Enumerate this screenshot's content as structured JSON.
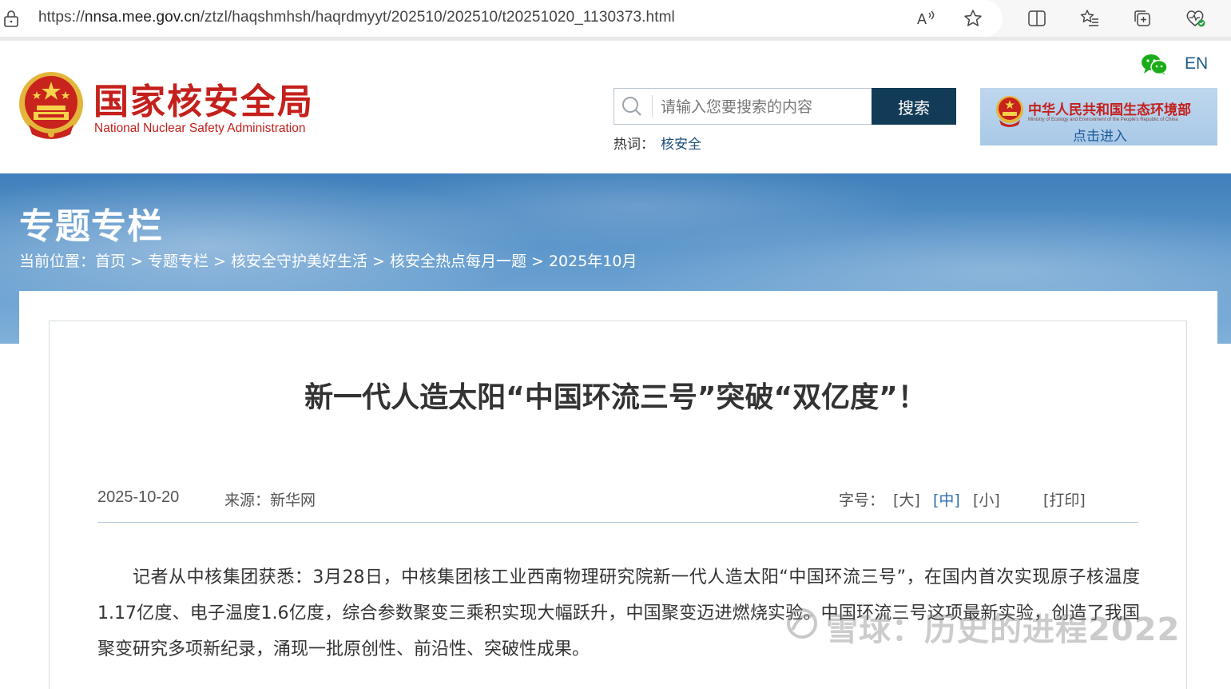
{
  "browser": {
    "url_prefix": "https://",
    "url_host": "nnsa.mee.gov.cn",
    "url_path": "/ztzl/haqshmhsh/haqrdmyyt/202510/202510/t20251020_1130373.html"
  },
  "header": {
    "site_title": "国家核安全局",
    "site_subtitle": "National Nuclear Safety Administration",
    "lang_link": "EN",
    "search": {
      "placeholder": "请输入您要搜索的内容",
      "button_label": "搜索"
    },
    "hotwords": {
      "label": "热词：",
      "items": [
        "核安全"
      ]
    },
    "ministry_banner": {
      "name": "中华人民共和国生态环境部",
      "english": "Ministry of Ecology and Environment of the People's Republic of China",
      "enter_label": "点击进入"
    }
  },
  "banner": {
    "title": "专题专栏",
    "breadcrumb": {
      "label": "当前位置：",
      "items": [
        "首页",
        "专题专栏",
        "核安全守护美好生活",
        "核安全热点每月一题",
        "2025年10月"
      ],
      "separator": ">"
    }
  },
  "article": {
    "title": "新一代人造太阳“中国环流三号”突破“双亿度”！",
    "date": "2025-10-20",
    "source": "来源：新华网",
    "font_size_label": "字号：",
    "font_sizes": [
      "[大]",
      "[中]",
      "[小]"
    ],
    "print_label": "[打印]",
    "body": "记者从中核集团获悉：3月28日，中核集团核工业西南物理研究院新一代人造太阳“中国环流三号”，在国内首次实现原子核温度1.17亿度、电子温度1.6亿度，综合参数聚变三乘积实现大幅跃升，中国聚变迈进燃烧实验。中国环流三号这项最新实验，创造了我国聚变研究多项新纪录，涌现一批原创性、前沿性、突破性成果。"
  },
  "watermark": "雪球：历史的进程2022",
  "colors": {
    "brand_red": "#c4201c",
    "search_button": "#123b57",
    "link_blue": "#1d4f7a",
    "banner_blue": "#5d97cb"
  }
}
